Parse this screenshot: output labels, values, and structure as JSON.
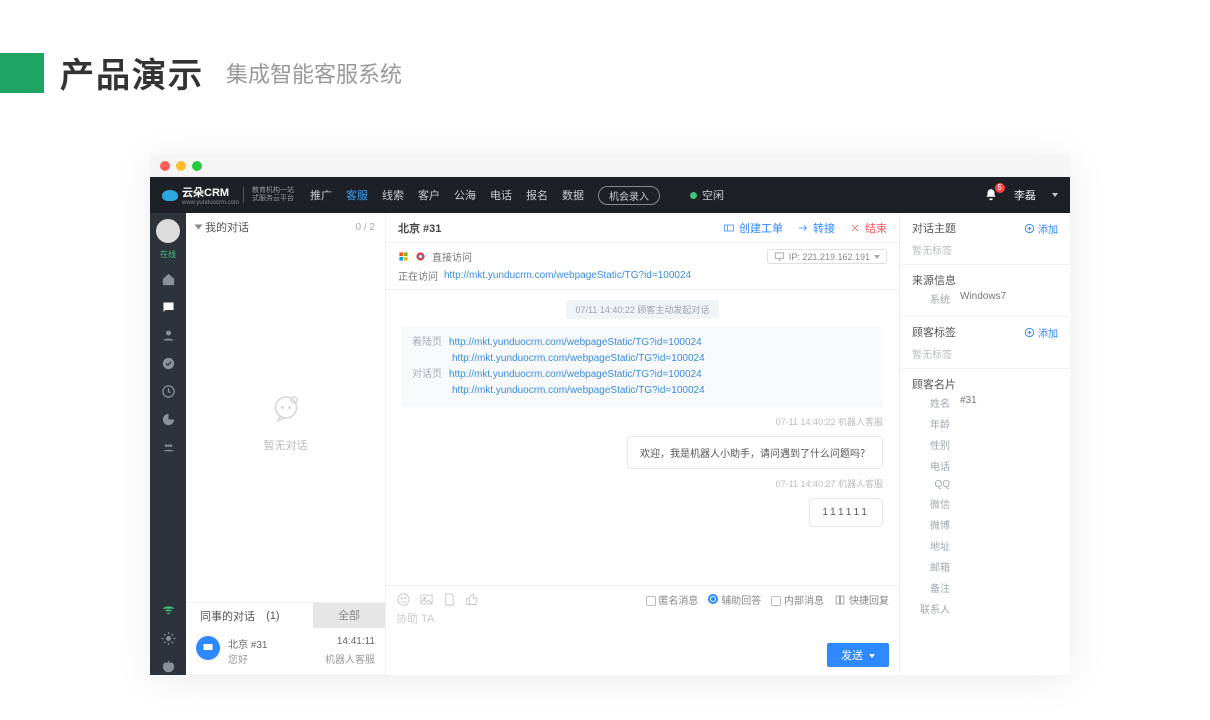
{
  "slide": {
    "title": "产品演示",
    "subtitle": "集成智能客服系统"
  },
  "logo": {
    "brand": "云朵CRM",
    "tag1": "教育机构一站",
    "tag2": "式服务云平台",
    "sub": "www.yunduocrm.com"
  },
  "nav": {
    "items": [
      "推广",
      "客服",
      "线索",
      "客户",
      "公海",
      "电话",
      "报名",
      "数据"
    ],
    "activeIndex": 1,
    "record": "机会录入",
    "status": "空闲",
    "user": "李磊",
    "badge": "5"
  },
  "left": {
    "myTitle": "我的对话",
    "myCount": "0 / 2",
    "empty": "暂无对话",
    "colleagueTitle": "同事的对话",
    "colleagueCount": "(1)",
    "all": "全部",
    "item": {
      "name": "北京 #31",
      "msg": "您好",
      "time": "14:41:11",
      "by": "机器人客服"
    }
  },
  "mid": {
    "title": "北京 #31",
    "actions": {
      "ticket": "创建工单",
      "transfer": "转接",
      "end": "结束"
    },
    "access": "直接访问",
    "visiting": "正在访问",
    "visitingUrl": "http://mkt.yunducrm.com/webpageStatic/TG?id=100024",
    "ip": "IP:  221.219.162.191",
    "sysPill": "07/11 14:40:22  顾客主动发起对话",
    "ref": {
      "landLabel": "着陆页",
      "landUrl1": "http://mkt.yunduocrm.com/webpageStatic/TG?id=100024",
      "landUrl2": "http://mkt.yunduocrm.com/webpageStatic/TG?id=100024",
      "talkLabel": "对话页",
      "talkUrl1": "http://mkt.yunduocrm.com/webpageStatic/TG?id=100024",
      "talkUrl2": "http://mkt.yunduocrm.com/webpageStatic/TG?id=100024"
    },
    "ts1": "07-11 14:40:22  机器人客服",
    "bubble1": "欢迎，我是机器人小助手，请问遇到了什么问题吗？",
    "ts2": "07-11 14:40:27  机器人客服",
    "bubble2": "111111",
    "opts": {
      "anon": "匿名消息",
      "assist": "辅助回答",
      "internal": "内部消息",
      "quick": "快捷回复"
    },
    "placeholder": "协助 TA",
    "send": "发送"
  },
  "right": {
    "topicTitle": "对话主题",
    "add": "添加",
    "noTag": "暂无标签",
    "sourceTitle": "来源信息",
    "system": "系统",
    "systemVal": "Windows7",
    "custTagTitle": "顾客标签",
    "noTag2": "暂无标签",
    "cardTitle": "顾客名片",
    "fields": {
      "name": "姓名",
      "nameVal": "#31",
      "age": "年龄",
      "gender": "性别",
      "phone": "电话",
      "qq": "QQ",
      "wechat": "微信",
      "weibo": "微博",
      "addr": "地址",
      "email": "邮箱",
      "note": "备注",
      "contact": "联系人"
    }
  }
}
